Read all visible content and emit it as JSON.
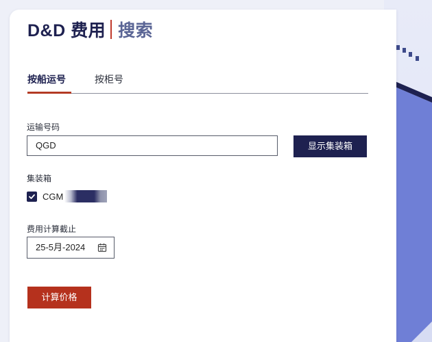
{
  "brand": {
    "part1": "D&D 费用",
    "part2": "搜索"
  },
  "tabs": [
    {
      "label": "按船运号",
      "active": true
    },
    {
      "label": "按柜号",
      "active": false
    }
  ],
  "transport": {
    "label": "运输号码",
    "value": "QGD",
    "show_button": "显示集装箱"
  },
  "containers": {
    "label": "集装箱",
    "items": [
      {
        "label": "CGM",
        "checked": true
      }
    ]
  },
  "date": {
    "label": "费用计算截止",
    "value": "25-5月-2024"
  },
  "calc_button": "计算价格",
  "colors": {
    "navy": "#1e2150",
    "accent_red": "#b5311d",
    "brand_secondary": "#5a6595"
  },
  "icons": {
    "calendar": "calendar-icon",
    "check": "checkmark-icon"
  }
}
